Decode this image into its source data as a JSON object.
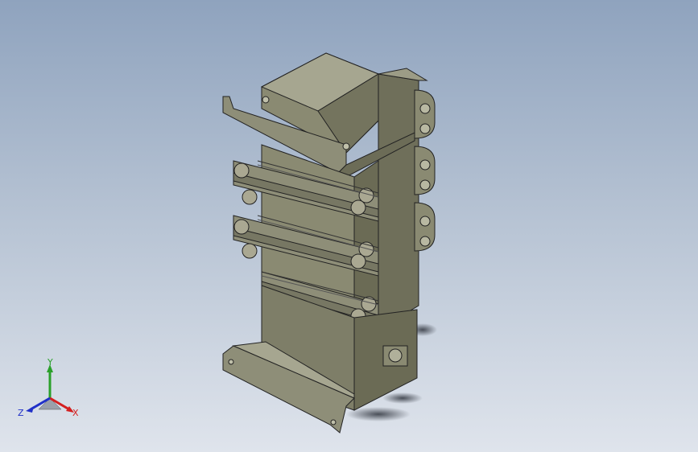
{
  "viewport": {
    "background_top": "#8fa3be",
    "background_bottom": "#dfe4ec"
  },
  "model": {
    "body_color": "#8a8a72",
    "body_dark": "#6b6b55",
    "body_light": "#a8a892",
    "edge_color": "#222222",
    "clamp_rows": 3
  },
  "triad": {
    "x_label": "X",
    "y_label": "Y",
    "z_label": "Z",
    "x_color": "#d42020",
    "y_color": "#2aa02a",
    "z_color": "#2030c8"
  }
}
